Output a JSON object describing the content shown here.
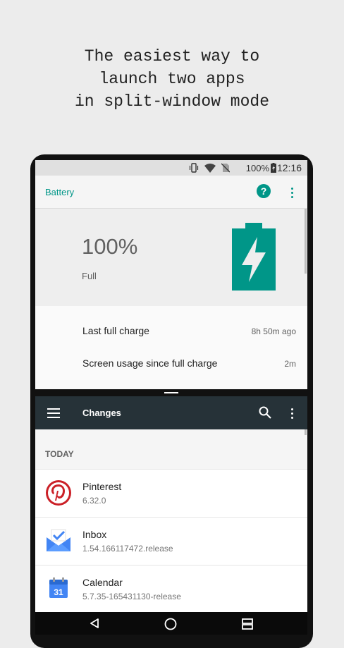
{
  "headline": {
    "line1": "The easiest way to",
    "line2": "launch two apps",
    "line3": "in split-window mode"
  },
  "status_bar": {
    "battery_percent": "100%",
    "time": "12:16",
    "icons": [
      "vibrate-icon",
      "wifi-icon",
      "no-sim-icon",
      "battery-charging-icon"
    ]
  },
  "battery_app": {
    "title": "Battery",
    "help_label": "?",
    "percent": "100%",
    "state": "Full",
    "rows": [
      {
        "label": "Last full charge",
        "value": "8h 50m ago"
      },
      {
        "label": "Screen usage since full charge",
        "value": "2m"
      }
    ],
    "accent_color": "#009688"
  },
  "changes_app": {
    "title": "Changes",
    "section": "TODAY",
    "toolbar_color": "#263238",
    "apps": [
      {
        "name": "Pinterest",
        "version": "6.32.0",
        "icon": "pinterest-icon"
      },
      {
        "name": "Inbox",
        "version": "1.54.166117472.release",
        "icon": "inbox-icon"
      },
      {
        "name": "Calendar",
        "version": "5.7.35-165431130-release",
        "icon": "calendar-icon",
        "icon_text": "31"
      }
    ]
  },
  "nav_bar": {
    "buttons": [
      "back-icon",
      "home-icon",
      "recents-icon"
    ]
  }
}
